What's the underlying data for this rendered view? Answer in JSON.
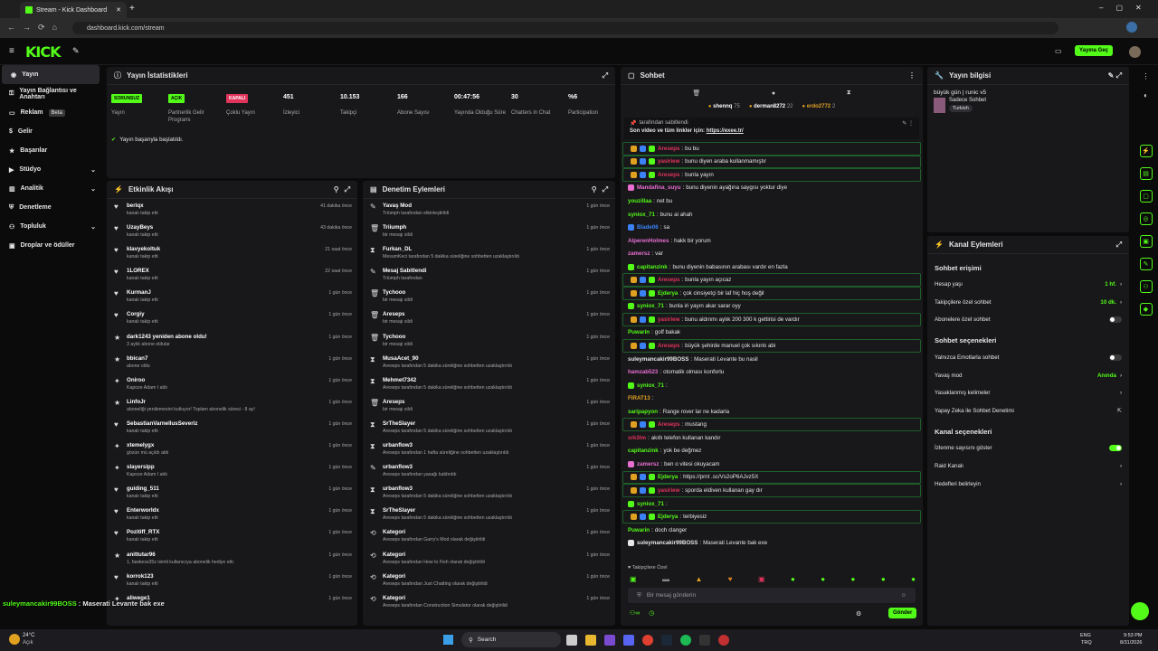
{
  "browser": {
    "tab_title": "Stream - Kick Dashboard",
    "url": "dashboard.kick.com/stream"
  },
  "header": {
    "logo": "KICK",
    "go_live": "Yayına Geç"
  },
  "sidebar": {
    "items": [
      {
        "label": "Yayın",
        "icon": "broadcast-icon"
      },
      {
        "label": "Yayın Bağlantısı ve Anahtarı",
        "icon": "key-icon"
      },
      {
        "label": "Reklam",
        "icon": "ad-icon",
        "badge": "Beta"
      },
      {
        "label": "Gelir",
        "icon": "money-icon"
      },
      {
        "label": "Başarılar",
        "icon": "trophy-icon"
      },
      {
        "label": "Stüdyo",
        "icon": "studio-icon"
      },
      {
        "label": "Analitik",
        "icon": "chart-icon"
      },
      {
        "label": "Denetleme",
        "icon": "shield-icon"
      },
      {
        "label": "Topluluk",
        "icon": "community-icon"
      },
      {
        "label": "Droplar ve ödüller",
        "icon": "gift-icon"
      }
    ]
  },
  "stats": {
    "title": "Yayın İstatistikleri",
    "status_msg": "Yayın başarıyla başlatıldı.",
    "items": [
      {
        "badge": "SORUNSUZ",
        "label": "Yayın"
      },
      {
        "badge": "AÇIK",
        "label": "Partnerlik Gelir Programı"
      },
      {
        "badge": "KAPALI",
        "label": "Çoklu Yayın"
      },
      {
        "value": "451",
        "label": "İzleyici"
      },
      {
        "value": "10.153",
        "label": "Takipçi"
      },
      {
        "value": "166",
        "label": "Abone Sayısı"
      },
      {
        "value": "00:47:56",
        "label": "Yayında Olduğu Süre"
      },
      {
        "value": "30",
        "label": "Chatters in Chat"
      },
      {
        "value": "%6",
        "label": "Participation"
      }
    ]
  },
  "activity": {
    "title": "Etkinlik Akışı",
    "rows": [
      {
        "name": "beriqx",
        "sub": "kanalı takip etti",
        "time": "41 dakika önce"
      },
      {
        "name": "UzayBeys",
        "sub": "kanalı takip etti",
        "time": "43 dakika önce"
      },
      {
        "name": "klavyekoltuk",
        "sub": "kanalı takip etti",
        "time": "21 saat önce"
      },
      {
        "name": "1LOREX",
        "sub": "kanalı takip etti",
        "time": "22 saat önce"
      },
      {
        "name": "KurmanJ",
        "sub": "kanalı takip etti",
        "time": "1 gün önce"
      },
      {
        "name": "Corgiy",
        "sub": "kanalı takip etti",
        "time": "1 gün önce"
      },
      {
        "name": "dark1243 yeniden abone oldu!",
        "sub": "3 aylık abone oldular",
        "time": "1 gün önce"
      },
      {
        "name": "bbican7",
        "sub": "abone oldu",
        "time": "1 gün önce"
      },
      {
        "name": "Oniroo",
        "sub": "Kapoze Adam I aldı",
        "time": "1 gün önce"
      },
      {
        "name": "LinfoJr",
        "sub": "aboneliği yenilemesini kutluyor! Toplam abonelik süresi - 8 ay!",
        "time": "1 gün önce"
      },
      {
        "name": "SebastianVarnellusSeveriz",
        "sub": "kanalı takip etti",
        "time": "1 gün önce"
      },
      {
        "name": "xtemelygx",
        "sub": "gözün mü açıldı aldı",
        "time": "1 gün önce"
      },
      {
        "name": "slayersipp",
        "sub": "Kapoze Adam I aldı",
        "time": "1 gün önce"
      },
      {
        "name": "guiding_511",
        "sub": "kanalı takip etti",
        "time": "1 gün önce"
      },
      {
        "name": "Enterworldx",
        "sub": "kanalı takip etti",
        "time": "1 gün önce"
      },
      {
        "name": "Pozitiff_RTX",
        "sub": "kanalı takip etti",
        "time": "1 gün önce"
      },
      {
        "name": "anittutar96",
        "sub": "1, fawkess35z isimli kullanıcıya abonelik hediye etti.",
        "time": "1 gün önce"
      },
      {
        "name": "korrok123",
        "sub": "kanalı takip etti",
        "time": "1 gün önce"
      },
      {
        "name": "aliwege1",
        "sub": "",
        "time": "1 gün önce"
      }
    ]
  },
  "moderation": {
    "title": "Denetim Eylemleri",
    "rows": [
      {
        "name": "Yavaş Mod",
        "sub": "Triümph tarafından etkinleştirildi",
        "time": "1 gün önce"
      },
      {
        "name": "Triiumph",
        "sub": "bir mesajı sildi",
        "time": "1 gün önce"
      },
      {
        "name": "Furkan_DL",
        "sub": "MesumKeci tarafından 5 dakika süreliğine sohbetten uzaklaştırıldı",
        "time": "1 gün önce"
      },
      {
        "name": "Mesaj Sabitlendi",
        "sub": "Triümph tarafından",
        "time": "1 gün önce"
      },
      {
        "name": "Tychooo",
        "sub": "bir mesajı sildi",
        "time": "1 gün önce"
      },
      {
        "name": "Areseps",
        "sub": "bir mesajı sildi",
        "time": "1 gün önce"
      },
      {
        "name": "Tychooo",
        "sub": "bir mesajı sildi",
        "time": "1 gün önce"
      },
      {
        "name": "MusaAcet_90",
        "sub": "Areseps tarafından 5 dakika süreliğine sohbetten uzaklaştırıldı",
        "time": "1 gün önce"
      },
      {
        "name": "Mehmet7342",
        "sub": "Areseps tarafından 5 dakika süreliğine sohbetten uzaklaştırıldı",
        "time": "1 gün önce"
      },
      {
        "name": "Areseps",
        "sub": "bir mesajı sildi",
        "time": "1 gün önce"
      },
      {
        "name": "SrTheSlayer",
        "sub": "Areseps tarafından 5 dakika süreliğine sohbetten uzaklaştırıldı",
        "time": "1 gün önce"
      },
      {
        "name": "urbanflow3",
        "sub": "Areseps tarafından 1 hafta süreliğine sohbetten uzaklaştırıldı",
        "time": "1 gün önce"
      },
      {
        "name": "urbanflow3",
        "sub": "Areseps tarafından yasağı kaldırıldı",
        "time": "1 gün önce"
      },
      {
        "name": "urbanflow3",
        "sub": "Areseps tarafından 5 dakika süreliğine sohbetten uzaklaştırıldı",
        "time": "1 gün önce"
      },
      {
        "name": "SrTheSlayer",
        "sub": "Areseps tarafından 5 dakika süreliğine sohbetten uzaklaştırıldı",
        "time": "1 gün önce"
      },
      {
        "name": "Kategori",
        "sub": "Areseps tarafından Garry's Mod olarak değiştirildi",
        "time": "1 gün önce"
      },
      {
        "name": "Kategori",
        "sub": "Areseps tarafından How to Fish olarak değiştirildi",
        "time": "1 gün önce"
      },
      {
        "name": "Kategori",
        "sub": "Areseps tarafından Just Chatting olarak değiştirildi",
        "time": "1 gün önce"
      },
      {
        "name": "Kategori",
        "sub": "Areseps tarafından Construction Simulator olarak değiştirildi",
        "time": "1 gün önce"
      }
    ]
  },
  "chat": {
    "title": "Sohbet",
    "top": [
      {
        "n": "shennq",
        "v": "75"
      },
      {
        "n": "derman8272",
        "v": "22"
      },
      {
        "n": "erdo2772",
        "v": "2"
      }
    ],
    "pinned_by": "tarafından sabitlendi",
    "pinned_text": "Son video ve tüm linkler için:",
    "pinned_link": "https://exee.tr/",
    "lines": [
      {
        "u": "Areseps",
        "c": "#e0345b",
        "t": "bu bu",
        "hl": true
      },
      {
        "u": "yasiriew",
        "c": "#e0345b",
        "t": "bunu diyen araba kullanmamıştır",
        "hl": true
      },
      {
        "u": "Areseps",
        "c": "#e0345b",
        "t": "bunla yayın",
        "hl": true
      },
      {
        "u": "Mandafina_suyu",
        "c": "#e86fd0",
        "t": "bunu diyenin ayağına saygısı yoktur diye"
      },
      {
        "u": "youzillaa",
        "c": "#53fc18",
        "t": "net bu"
      },
      {
        "u": "syniox_71",
        "c": "#53fc18",
        "t": "bunu ai ahah"
      },
      {
        "u": "Blade06",
        "c": "#3b82f6",
        "t": "sa"
      },
      {
        "u": "AlperenHolmes",
        "c": "#e86fd0",
        "t": "hakk bir yorum"
      },
      {
        "u": "zamersz",
        "c": "#e86fd0",
        "t": "var"
      },
      {
        "u": "capitanzink",
        "c": "#53fc18",
        "t": "bunu diyenin babasının arabası vardır en fazla"
      },
      {
        "u": "Areseps",
        "c": "#e0345b",
        "t": "bunla yayın açıcaz",
        "hl": true
      },
      {
        "u": "Ejderya",
        "c": "#53fc18",
        "t": "çok cinsiyetçi bir laf hiç hoş değil",
        "hl": true
      },
      {
        "u": "syniox_71",
        "c": "#53fc18",
        "t": "bunla iri yayın akar sarar oyy"
      },
      {
        "u": "yasiriew",
        "c": "#e0345b",
        "t": "bunu aldınmı aylık 200 300 k gettirisi de vardır",
        "hl": true
      },
      {
        "u": "Puwarin",
        "c": "#53fc18",
        "t": "golf bakak"
      },
      {
        "u": "Areseps",
        "c": "#e0345b",
        "t": "büyük şehirde manuel çok sıkıntı abi",
        "hl": true
      },
      {
        "u": "suleymancakir99BOSS",
        "c": "#e6e6e6",
        "t": "Maserati Levante bu nasil"
      },
      {
        "u": "hamzab523",
        "c": "#e86fd0",
        "t": "otomatik olması konforlu"
      },
      {
        "u": "syniox_71",
        "c": "#53fc18",
        "t": ""
      },
      {
        "u": "FIRAT13",
        "c": "#e0a020",
        "t": ""
      },
      {
        "u": "saripapyon",
        "c": "#53fc18",
        "t": "Range rover lar ne kadarla"
      },
      {
        "u": "Areseps",
        "c": "#e0345b",
        "t": "mustang",
        "hl": true
      },
      {
        "u": "srk3lm",
        "c": "#e0345b",
        "t": "akıllı telefon kullanan kandır"
      },
      {
        "u": "capitanzink",
        "c": "#53fc18",
        "t": "yok be değmez"
      },
      {
        "u": "zamersz",
        "c": "#e86fd0",
        "t": "ben o vitesi okuyacam"
      },
      {
        "u": "Ejderya",
        "c": "#53fc18",
        "t": "https://prnt .sc/Vs2oP6AJvz5X",
        "hl": true
      },
      {
        "u": "yasiriew",
        "c": "#e0345b",
        "t": "sporda eldiven kullanan gay dır",
        "hl": true
      },
      {
        "u": "syniox_71",
        "c": "#53fc18",
        "t": ""
      },
      {
        "u": "Ejderya",
        "c": "#53fc18",
        "t": "terbiyesiz",
        "hl": true
      },
      {
        "u": "Puwarin",
        "c": "#53fc18",
        "t": "doch clanger"
      },
      {
        "u": "suleymancakir99BOSS",
        "c": "#e6e6e6",
        "t": "Maserati Levante bak exe"
      }
    ],
    "followers_only": "Takipçilere Özel",
    "placeholder": "Bir mesaj gönderin",
    "send": "Gönder"
  },
  "info": {
    "title": "Yayın bilgisi",
    "stream_title": "büyük gün | runic v5",
    "category": "Sadece Sohbet",
    "language": "Turkish"
  },
  "channel": {
    "title": "Kanal Eylemleri",
    "chat_access": "Sohbet erişimi",
    "access": [
      {
        "l": "Hesap yaşı",
        "v": "1 hf."
      },
      {
        "l": "Takipçilere özel sohbet",
        "v": "10 dk."
      },
      {
        "l": "Abonelere özel sohbet",
        "toggle": false
      }
    ],
    "chat_options": "Sohbet seçenekleri",
    "options": [
      {
        "l": "Yalnızca Emotlarla sohbet",
        "toggle": false
      },
      {
        "l": "Yavaş mod",
        "v": "Anında"
      },
      {
        "l": "Yasaklanmış kelimeler",
        "v": ""
      },
      {
        "l": "Yapay Zeka ile Sohbet Denetimi",
        "v": ""
      }
    ],
    "channel_options": "Kanal seçenekleri",
    "copts": [
      {
        "l": "İzlenme sayısını göster",
        "toggle": true
      },
      {
        "l": "Raid Kanalı",
        "v": ""
      },
      {
        "l": "Hedefleri belirleyin",
        "v": ""
      }
    ]
  },
  "overlay": {
    "user": "suleymancakir99BOSS",
    "text": "Maserati Levante bak exe"
  },
  "taskbar": {
    "weather": "24°C",
    "weather_sub": "Açık",
    "search": "Search",
    "lang": "ENG",
    "lang2": "TRQ",
    "time": "9:53 PM",
    "date": "8/31/2026"
  },
  "colors": {
    "accent": "#53fc18",
    "bg": "#0b0b0c",
    "panel": "#18181b"
  }
}
